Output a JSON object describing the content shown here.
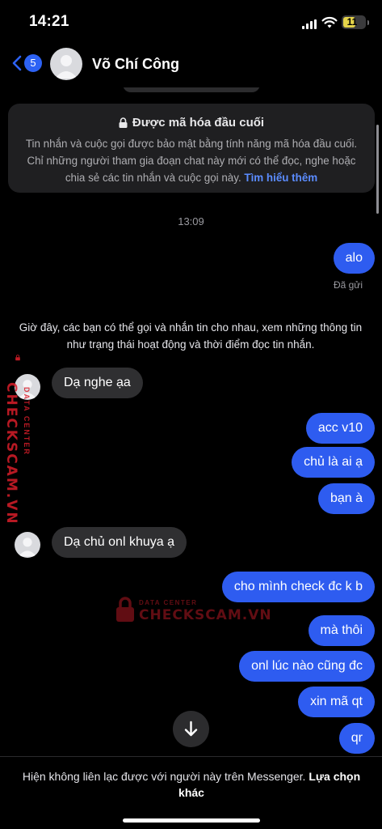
{
  "status_bar": {
    "time": "14:21",
    "battery": "11",
    "battery_color": "#e5d44a"
  },
  "header": {
    "back_badge": "5",
    "contact_name": "Võ Chí Công",
    "accent": "#2d62f4"
  },
  "encryption_notice": {
    "title": "Được mã hóa đầu cuối",
    "body": "Tin nhắn và cuộc gọi được bảo mật bằng tính năng mã hóa đầu cuối. Chỉ những người tham gia đoạn chat này mới có thể đọc, nghe hoặc chia sẻ các tin nhắn và cuộc gọi này.",
    "link": "Tìm hiểu thêm"
  },
  "timestamp": "13:09",
  "delivered_label": "Đã gửi",
  "system_message": "Giờ đây, các bạn có thể gọi và nhắn tin cho nhau, xem những thông tin như trạng thái hoạt động và thời điểm đọc tin nhắn.",
  "messages": [
    {
      "from": "me",
      "text": "alo"
    },
    {
      "from": "them",
      "text": "Dạ nghe ạa"
    },
    {
      "from": "me",
      "text": "acc v10"
    },
    {
      "from": "me",
      "text": "chủ là ai ạ"
    },
    {
      "from": "me",
      "text": "bạn à"
    },
    {
      "from": "them",
      "text": "Dạ chủ onl khuya ạ"
    },
    {
      "from": "me",
      "text": "cho mình check đc k b"
    },
    {
      "from": "me",
      "text": "mà thôi"
    },
    {
      "from": "me",
      "text": "onl lúc nào cũng đc"
    },
    {
      "from": "me",
      "text": "xin mã qt"
    },
    {
      "from": "me",
      "text": "qr"
    }
  ],
  "watermark": {
    "brand": "CHECKSCAM.VN",
    "sub": "DATA CENTER",
    "color": "#d81e2a"
  },
  "footer": {
    "text": "Hiện không liên lạc được với người này trên Messenger.",
    "link": "Lựa chọn khác"
  },
  "colors": {
    "outgoing_bubble": "#2e5cf0",
    "incoming_bubble": "#2f2f31",
    "link": "#5b8cff"
  }
}
